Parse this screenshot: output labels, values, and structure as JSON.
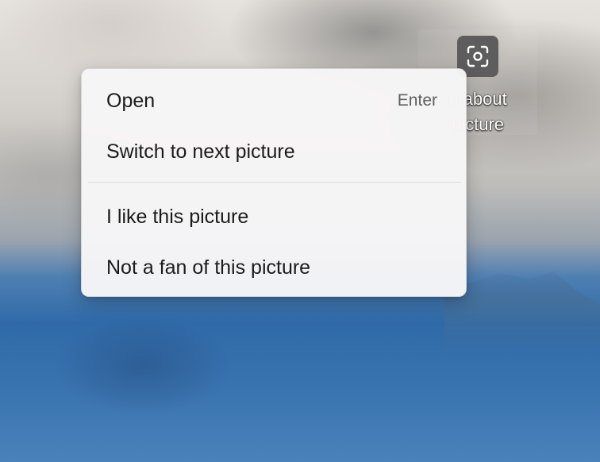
{
  "desktop": {
    "widget": {
      "icon": "camera-focus-icon",
      "label_line1": "n about",
      "label_line2": "picture"
    }
  },
  "context_menu": {
    "items": [
      {
        "label": "Open",
        "shortcut": "Enter"
      },
      {
        "label": "Switch to next picture"
      },
      {
        "label": "I like this picture"
      },
      {
        "label": "Not a fan of this picture"
      }
    ]
  },
  "colors": {
    "menu_background": "#f7f6f7",
    "menu_text": "#1b1b1b",
    "shortcut_text": "#5f5f5f",
    "widget_icon_bg": "#5d5d5d"
  }
}
